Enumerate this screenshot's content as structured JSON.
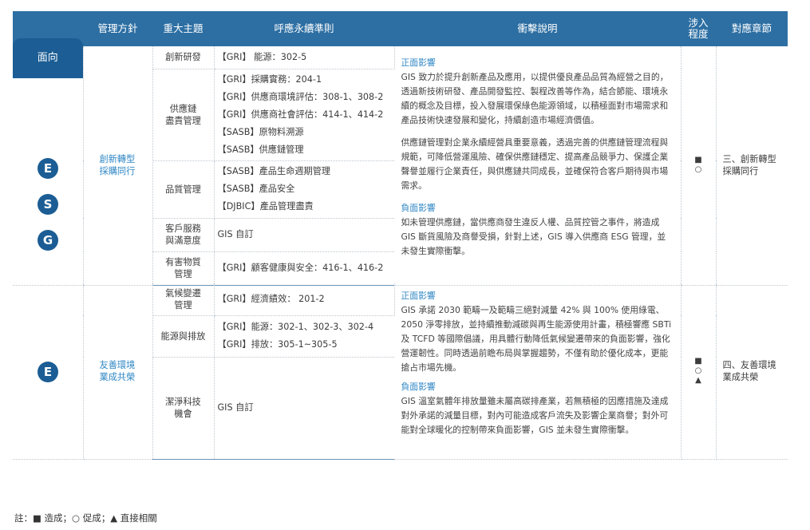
{
  "header": {
    "face": "面向",
    "policy": "管理方針",
    "topic": "重大主題",
    "standard": "呼應永續準則",
    "impact": "衝擊說明",
    "involvement": "涉入\n程度",
    "chapter": "對應章節"
  },
  "groups": [
    {
      "esg_letters": [
        "E",
        "S",
        "G"
      ],
      "policy": "創新轉型\n採購同行",
      "rows": [
        {
          "topic": "創新研發",
          "standards": [
            "【GRI】 能源：302-5"
          ]
        },
        {
          "topic": "供應鏈\n盡責管理",
          "standards": [
            "【GRI】採購實務：204-1",
            "【GRI】供應商環境評估：308-1、308-2",
            "【GRI】供應商社會評估：414-1、414-2",
            "【SASB】原物料溯源",
            "【SASB】供應鏈管理"
          ]
        },
        {
          "topic": "品質管理",
          "standards": [
            "【SASB】產品生命週期管理",
            "【SASB】產品安全",
            "【DJBIC】產品管理盡責"
          ]
        },
        {
          "topic": "客戶服務\n與滿意度",
          "standards": [
            "GIS 自訂"
          ]
        },
        {
          "topic": "有害物質\n管理",
          "standards": [
            "【GRI】顧客健康與安全：416-1、416-2"
          ]
        }
      ],
      "impact": [
        {
          "heading": "正面影響",
          "text": "GIS 致力於提升創新產品及應用，以提供優良產品品質為經營之目的，透過新技術研發、產品開發監控、製程改善等作為，結合節能、環境永續的概念及目標，投入發展環保綠色能源領域，以積極面對市場需求和產品技術快速發展和變化，持續創造市場經濟價值。"
        },
        {
          "heading": "",
          "text": "供應鏈管理對企業永續經營具重要意義，透過完善的供應鏈管理流程與規範，可降低營運風險、確保供應鏈穩定、提高產品競爭力、保護企業聲譽並履行企業責任，與供應鏈共同成長，並確保符合客戶期待與市場需求。"
        },
        {
          "heading": "負面影響",
          "text": "如未管理供應鏈，當供應商發生違反人權、品質控管之事件，將造成 GIS 斷貨風險及商譽受損，針對上述，GIS 導入供應商 ESG 管理，並未發生實際衝擊。"
        }
      ],
      "marks": [
        "■",
        "○"
      ],
      "chapter": "三、創新轉型\n採購同行"
    },
    {
      "esg_letters": [
        "E"
      ],
      "policy": "友善環境\n業成共榮",
      "rows": [
        {
          "topic": "氣候變遷\n管理",
          "standards": [
            "【GRI】經濟績效： 201-2"
          ]
        },
        {
          "topic": "能源與排放",
          "standards": [
            "【GRI】能源：302-1、302-3、302-4",
            "【GRI】排放：305-1~305-5"
          ]
        },
        {
          "topic": "潔淨科技\n機會",
          "standards": [
            "GIS 自訂"
          ]
        }
      ],
      "impact": [
        {
          "heading": "正面影響",
          "text": "GIS 承諾 2030 範疇一及範疇三絕對減量 42% 與 100% 使用綠電、2050 淨零排放，並持續推動減碳與再生能源使用計畫，積極響應 SBTi 及 TCFD 等國際倡議，用具體行動降低氣候變遷帶來的負面影響，強化營運韌性。同時透過前瞻布局與掌握趨勢，不僅有助於優化成本，更能搶占市場先機。"
        },
        {
          "heading": "負面影響",
          "text": "GIS 溫室氣體年排放量雖未屬高碳排產業，若無積極的因應措施及達成對外承諾的減量目標，對內可能造成客戶流失及影響企業商譽；對外可能對全球暖化的控制帶來負面影響，GIS 並未發生實際衝擊。"
        }
      ],
      "marks": [
        "■",
        "○",
        "▲"
      ],
      "chapter": "四、友善環境\n業成共榮"
    }
  ],
  "note": "註：■ 造成；○ 促成；▲ 直接相關"
}
